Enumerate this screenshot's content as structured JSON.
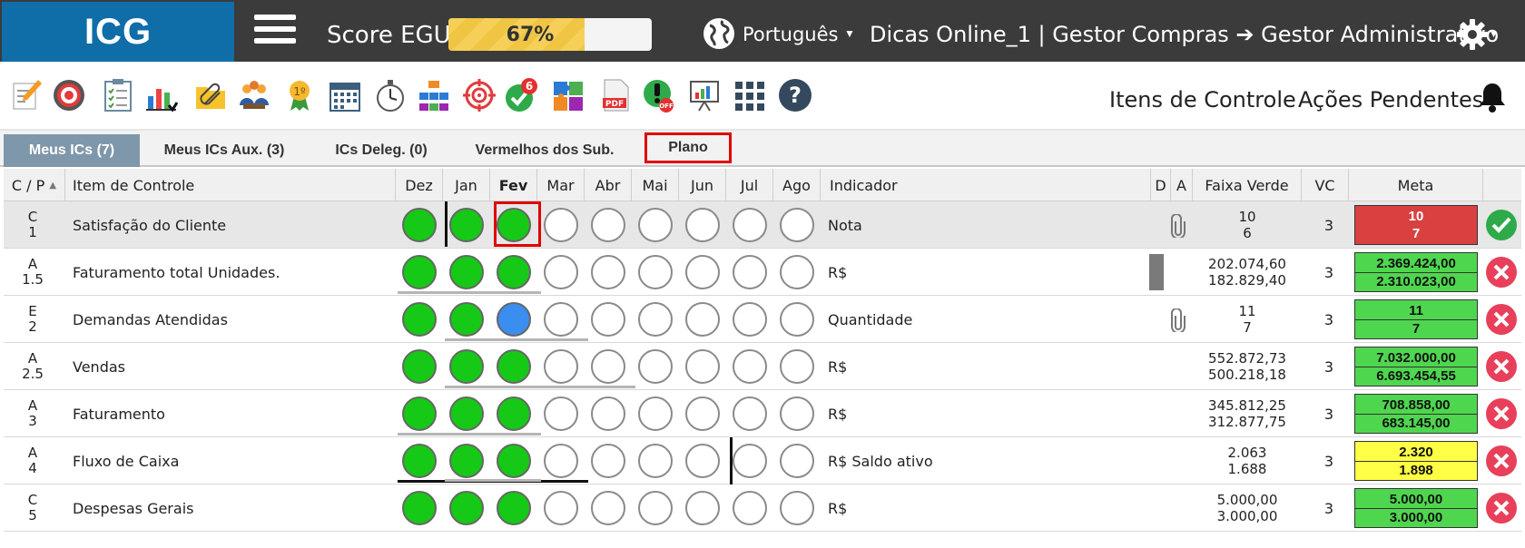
{
  "header": {
    "logo": "ICG",
    "score_label": "Score EGU:",
    "score_value": "67%",
    "score_fraction": 0.67,
    "language": "Português",
    "profile": "Dicas Online_1  |  Gestor Compras ➔ Gestor Administrativo"
  },
  "toolbar": {
    "icons": [
      "edit-icon",
      "target-icon",
      "checklist-icon",
      "chart-icon",
      "attachment-icon",
      "meeting-icon",
      "award-icon",
      "calendar-icon",
      "stopwatch-icon",
      "org-chart-icon",
      "crosshair-icon",
      "approvals-icon",
      "puzzle-icon",
      "pdf-icon",
      "alert-off-icon",
      "presentation-icon",
      "apps-grid-icon",
      "help-icon"
    ],
    "approvals_badge": "6",
    "links": [
      "Itens de Controle",
      "Ações Pendentes"
    ]
  },
  "tabs": [
    "Meus ICs (7)",
    "Meus ICs Aux. (3)",
    "ICs Deleg. (0)",
    "Vermelhos dos Sub.",
    "Plano"
  ],
  "table": {
    "headers": {
      "cp": "C / P",
      "item": "Item de Controle",
      "months": [
        "Dez",
        "Jan",
        "Fev",
        "Mar",
        "Abr",
        "Mai",
        "Jun",
        "Jul",
        "Ago"
      ],
      "indicator": "Indicador",
      "d": "D",
      "a": "A",
      "faixa": "Faixa Verde",
      "vc": "VC",
      "meta": "Meta"
    },
    "rows": [
      {
        "c": "C",
        "p": "1",
        "item": "Satisfação do Cliente",
        "dots": [
          "g",
          "g",
          "g",
          "e",
          "e",
          "e",
          "e",
          "e",
          "e"
        ],
        "indicator": "Nota",
        "faixa1": "10",
        "faixa2": "6",
        "vc": "3",
        "meta1": "10",
        "meta2": "7",
        "meta_color": "red",
        "status": "ok",
        "clip": true
      },
      {
        "c": "A",
        "p": "1.5",
        "item": "Faturamento total Unidades.",
        "dots": [
          "g",
          "g",
          "g",
          "e",
          "e",
          "e",
          "e",
          "e",
          "e"
        ],
        "indicator": "R$",
        "faixa1": "202.074,60",
        "faixa2": "182.829,40",
        "vc": "3",
        "meta1": "2.369.424,00",
        "meta2": "2.310.023,00",
        "meta_color": "green",
        "status": "no",
        "dbar": true
      },
      {
        "c": "E",
        "p": "2",
        "item": "Demandas Atendidas",
        "dots": [
          "g",
          "g",
          "b",
          "e",
          "e",
          "e",
          "e",
          "e",
          "e"
        ],
        "indicator": "Quantidade",
        "faixa1": "11",
        "faixa2": "7",
        "vc": "3",
        "meta1": "11",
        "meta2": "7",
        "meta_color": "green",
        "status": "no",
        "clip": true
      },
      {
        "c": "A",
        "p": "2.5",
        "item": "Vendas",
        "dots": [
          "g",
          "g",
          "g",
          "e",
          "e",
          "e",
          "e",
          "e",
          "e"
        ],
        "indicator": "R$",
        "faixa1": "552.872,73",
        "faixa2": "500.218,18",
        "vc": "3",
        "meta1": "7.032.000,00",
        "meta2": "6.693.454,55",
        "meta_color": "green",
        "status": "no"
      },
      {
        "c": "A",
        "p": "3",
        "item": "Faturamento",
        "dots": [
          "g",
          "g",
          "g",
          "e",
          "e",
          "e",
          "e",
          "e",
          "e"
        ],
        "indicator": "R$",
        "faixa1": "345.812,25",
        "faixa2": "312.877,75",
        "vc": "3",
        "meta1": "708.858,00",
        "meta2": "683.145,00",
        "meta_color": "green",
        "status": "no"
      },
      {
        "c": "A",
        "p": "4",
        "item": "Fluxo de Caixa",
        "dots": [
          "g",
          "g",
          "g",
          "e",
          "e",
          "e",
          "e",
          "e",
          "e"
        ],
        "indicator": "R$ Saldo ativo",
        "faixa1": "2.063",
        "faixa2": "1.688",
        "vc": "3",
        "meta1": "2.320",
        "meta2": "1.898",
        "meta_color": "yellow",
        "status": "no"
      },
      {
        "c": "C",
        "p": "5",
        "item": "Despesas Gerais",
        "dots": [
          "g",
          "g",
          "g",
          "e",
          "e",
          "e",
          "e",
          "e",
          "e"
        ],
        "indicator": "R$",
        "faixa1": "5.000,00",
        "faixa2": "3.000,00",
        "vc": "3",
        "meta1": "5.000,00",
        "meta2": "3.000,00",
        "meta_color": "green",
        "status": "no"
      }
    ]
  },
  "colors": {
    "header_bg": "#3b3b3b",
    "logo_bg": "#0f6da8",
    "active_tab": "#7f97aa",
    "dot_green": "#16c916",
    "dot_blue": "#3a8ef0",
    "highlight": "#e00000"
  }
}
